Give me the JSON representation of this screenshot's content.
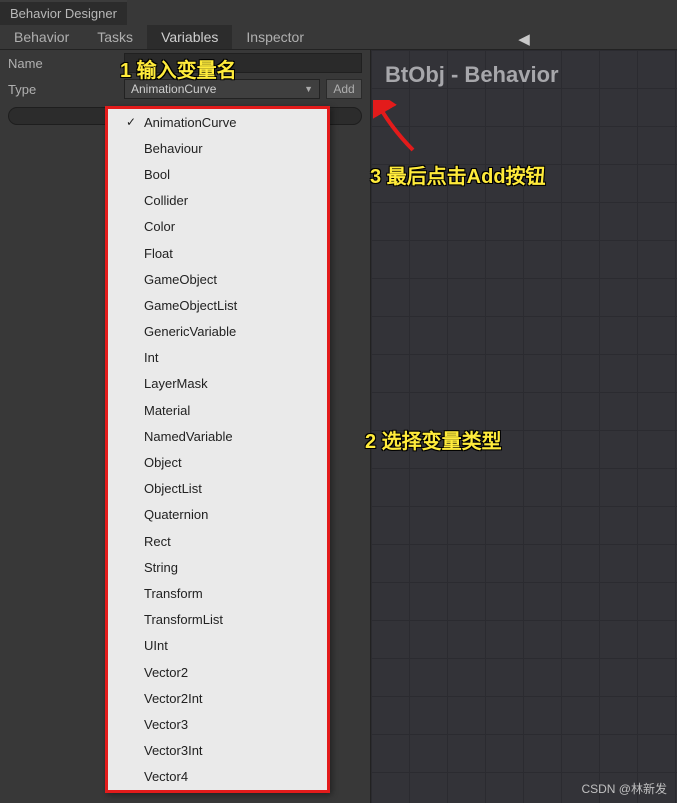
{
  "window": {
    "tab": "Behavior Designer"
  },
  "tabs": [
    "Behavior",
    "Tasks",
    "Variables",
    "Inspector"
  ],
  "active_tab": "Variables",
  "fields": {
    "name_label": "Name",
    "name_value": "",
    "type_label": "Type",
    "type_selected": "AnimationCurve",
    "add_label": "Add",
    "search_value": ""
  },
  "dropdown_options": [
    "AnimationCurve",
    "Behaviour",
    "Bool",
    "Collider",
    "Color",
    "Float",
    "GameObject",
    "GameObjectList",
    "GenericVariable",
    "Int",
    "LayerMask",
    "Material",
    "NamedVariable",
    "Object",
    "ObjectList",
    "Quaternion",
    "Rect",
    "String",
    "Transform",
    "TransformList",
    "UInt",
    "Vector2",
    "Vector2Int",
    "Vector3",
    "Vector3Int",
    "Vector4"
  ],
  "dropdown_selected": "AnimationCurve",
  "canvas": {
    "title": "BtObj - Behavior",
    "back_glyph": "◀"
  },
  "annotations": {
    "a1": "1 输入变量名",
    "a2": "2 选择变量类型",
    "a3": "3 最后点击Add按钮"
  },
  "watermark": "CSDN @林新发"
}
